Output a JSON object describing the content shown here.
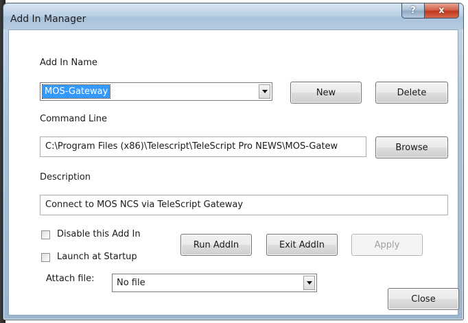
{
  "window": {
    "title": "Add In Manager",
    "help_glyph": "?",
    "close_glyph": "x"
  },
  "addin_name": {
    "label": "Add In Name",
    "selected": "MOS-Gateway"
  },
  "buttons": {
    "new": "New",
    "delete": "Delete",
    "browse": "Browse",
    "run": "Run AddIn",
    "exit": "Exit AddIn",
    "apply": "Apply",
    "close": "Close"
  },
  "command_line": {
    "label": "Command Line",
    "value": "C:\\Program Files (x86)\\Telescript\\TeleScript Pro NEWS\\MOS-Gatew"
  },
  "description": {
    "label": "Description",
    "value": "Connect to MOS NCS via TeleScript Gateway"
  },
  "options": {
    "disable_label": "Disable this Add In",
    "disable_checked": false,
    "launch_label": "Launch at Startup",
    "launch_checked": false
  },
  "attach": {
    "label": "Attach file:",
    "selected": "No file"
  },
  "colors": {
    "selection": "#3399ff",
    "close_button": "#c0371c"
  }
}
